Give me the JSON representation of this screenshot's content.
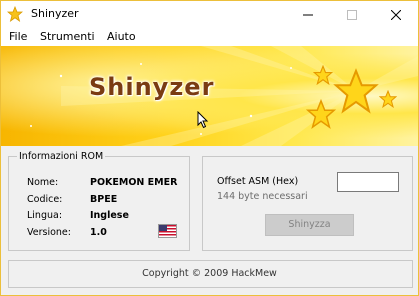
{
  "window": {
    "title": "Shinyzer",
    "icon": "star-icon",
    "controls": [
      "minimize-icon",
      "maximize-icon",
      "close-icon"
    ]
  },
  "menu": {
    "items": [
      {
        "label": "File"
      },
      {
        "label": "Strumenti"
      },
      {
        "label": "Aiuto"
      }
    ]
  },
  "banner": {
    "logo_text": "Shinyzer"
  },
  "rom_info": {
    "title": "Informazioni ROM",
    "fields": [
      {
        "label": "Nome:",
        "value": "POKEMON EMER"
      },
      {
        "label": "Codice:",
        "value": "BPEE"
      },
      {
        "label": "Lingua:",
        "value": "Inglese"
      },
      {
        "label": "Versione:",
        "value": "1.0"
      }
    ],
    "flag": "us-flag-icon"
  },
  "offset": {
    "label": "Offset ASM (Hex)",
    "value": "",
    "note": "144 byte necessari",
    "button_label": "Shinyzza"
  },
  "footer": {
    "copyright": "Copyright © 2009 HackMew"
  },
  "colors": {
    "banner_yellow": "#ffd21a",
    "logo_brown": "#7a3b12",
    "window_border": "#ecbf3a"
  }
}
